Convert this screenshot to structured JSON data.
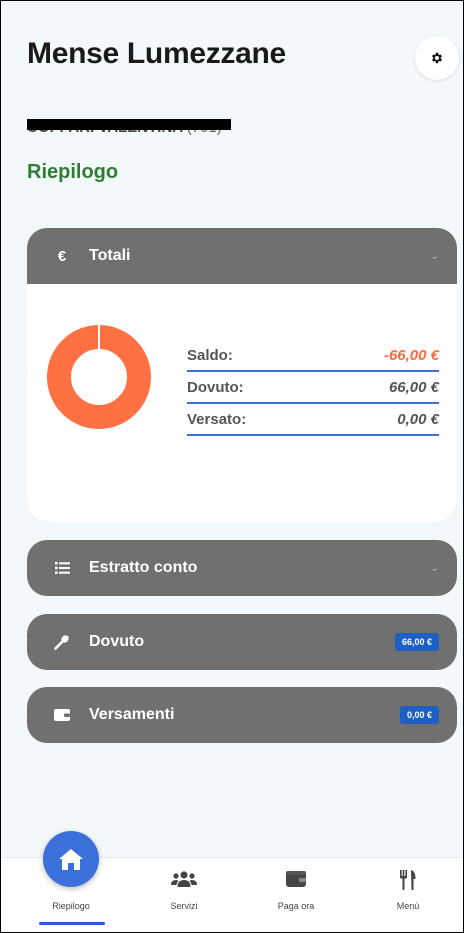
{
  "app": {
    "title": "Mense Lumezzane"
  },
  "user": {
    "name_redacted": "COPPARI VALENTINA",
    "suffix": "(701)"
  },
  "section": {
    "title": "Riepilogo"
  },
  "totali": {
    "label": "Totali",
    "icon": "euro-icon",
    "rows": [
      {
        "label": "Saldo:",
        "value": "-66,00 €",
        "negative": true
      },
      {
        "label": "Dovuto:",
        "value": "66,00 €",
        "negative": false
      },
      {
        "label": "Versato:",
        "value": "0,00 €",
        "negative": false
      }
    ],
    "chart_colors": {
      "dovuto": "#ff7043",
      "versato": "#ffffff"
    }
  },
  "estratto": {
    "label": "Estratto conto",
    "icon": "list-icon"
  },
  "dovuto": {
    "label": "Dovuto",
    "icon": "spoon-icon",
    "badge": "66,00 €"
  },
  "versamenti": {
    "label": "Versamenti",
    "icon": "wallet-icon",
    "badge": "0,00 €"
  },
  "nav": {
    "items": [
      {
        "label": "Riepilogo",
        "icon": "home-icon",
        "active": true
      },
      {
        "label": "Servizi",
        "icon": "users-icon",
        "active": false
      },
      {
        "label": "Paga ora",
        "icon": "wallet-icon",
        "active": false
      },
      {
        "label": "Menù",
        "icon": "utensils-icon",
        "active": false
      }
    ]
  },
  "colors": {
    "accent": "#3b6fd9",
    "section_title": "#2e7d32",
    "card_header": "#707070",
    "badge": "#1e5fc4",
    "negative": "#ff6a3d"
  }
}
